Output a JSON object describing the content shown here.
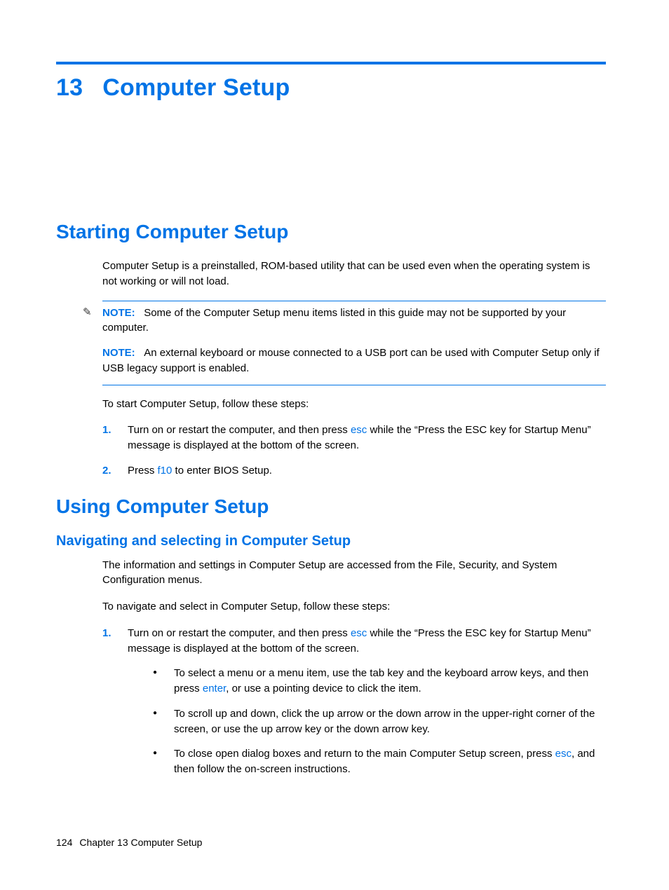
{
  "chapter": {
    "number": "13",
    "title": "Computer Setup"
  },
  "section1": {
    "heading": "Starting Computer Setup",
    "intro": "Computer Setup is a preinstalled, ROM-based utility that can be used even when the operating system is not working or will not load.",
    "note1_label": "NOTE:",
    "note1_text": "Some of the Computer Setup menu items listed in this guide may not be supported by your computer.",
    "note2_label": "NOTE:",
    "note2_text": "An external keyboard or mouse connected to a USB port can be used with Computer Setup only if USB legacy support is enabled.",
    "lead_in": "To start Computer Setup, follow these steps:",
    "step1_num": "1.",
    "step1_pre": "Turn on or restart the computer, and then press ",
    "step1_key": "esc",
    "step1_post": " while the “Press the ESC key for Startup Menu” message is displayed at the bottom of the screen.",
    "step2_num": "2.",
    "step2_pre": "Press ",
    "step2_key": "f10",
    "step2_post": " to enter BIOS Setup."
  },
  "section2": {
    "heading": "Using Computer Setup",
    "sub": {
      "heading": "Navigating and selecting in Computer Setup",
      "intro": "The information and settings in Computer Setup are accessed from the File, Security, and System Configuration menus.",
      "lead_in": "To navigate and select in Computer Setup, follow these steps:",
      "step1_num": "1.",
      "step1_pre": "Turn on or restart the computer, and then press ",
      "step1_key": "esc",
      "step1_post": " while the “Press the ESC key for Startup Menu” message is displayed at the bottom of the screen.",
      "b1_pre": "To select a menu or a menu item, use the tab key and the keyboard arrow keys, and then press ",
      "b1_key": "enter",
      "b1_post": ", or use a pointing device to click the item.",
      "b2": "To scroll up and down, click the up arrow or the down arrow in the upper-right corner of the screen, or use the up arrow key or the down arrow key.",
      "b3_pre": "To close open dialog boxes and return to the main Computer Setup screen, press ",
      "b3_key": "esc",
      "b3_post": ", and then follow the on-screen instructions."
    }
  },
  "footer": {
    "page": "124",
    "label": "Chapter 13   Computer Setup"
  }
}
